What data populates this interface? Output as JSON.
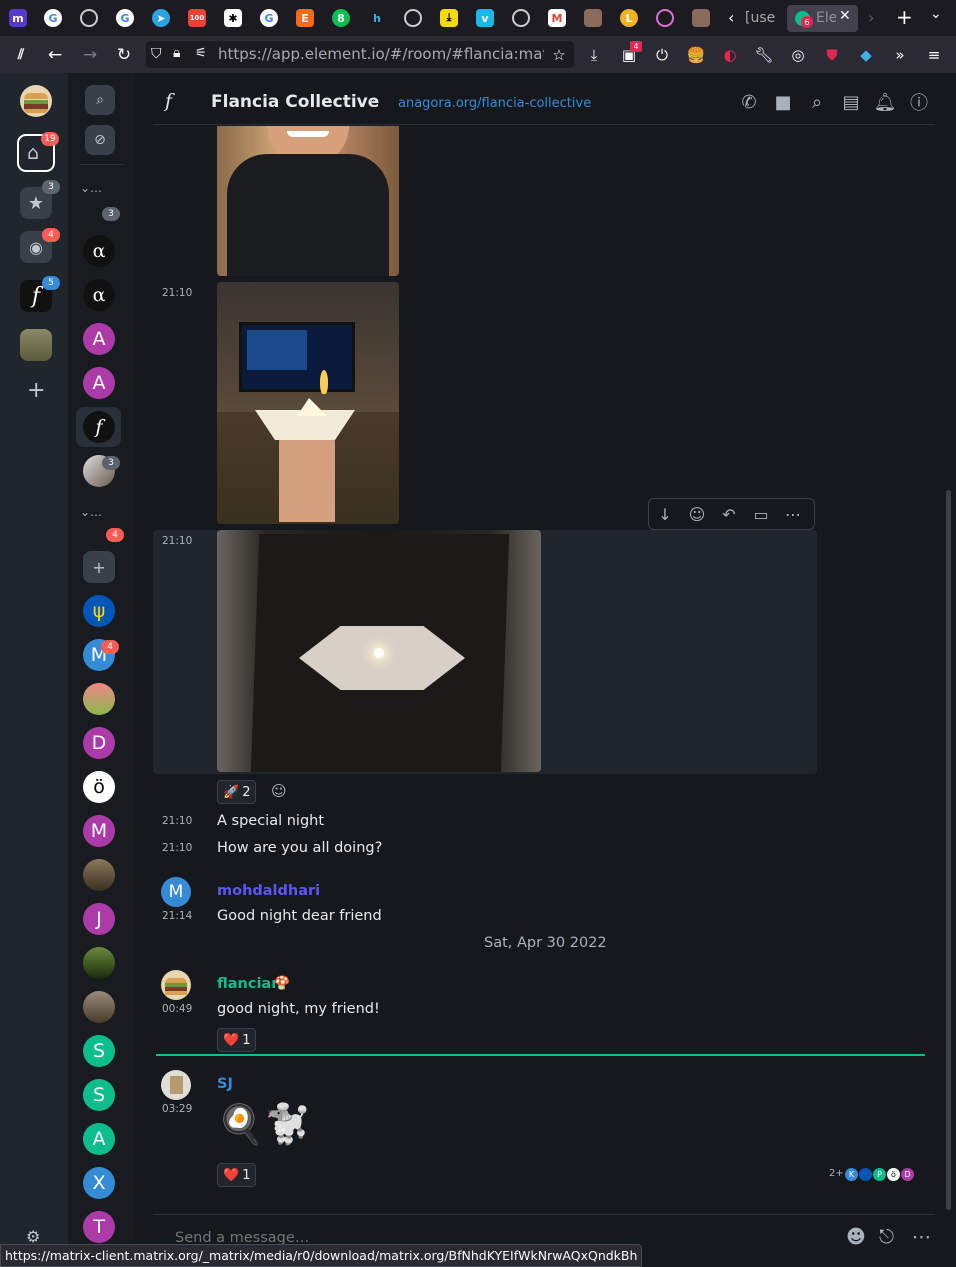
{
  "browser": {
    "url": "https://app.element.io/#/room/#flancia:matrix",
    "tabs": [
      {
        "label": "[use"
      },
      {
        "label": "Ele"
      }
    ],
    "tab_badge": "6",
    "ext_badge": "4",
    "status_url": "https://matrix-client.matrix.org/_matrix/media/r0/download/matrix.org/BfNhdKYEIfWkNrwAQxQndkBh"
  },
  "spaces": {
    "home_badge": "19",
    "favourites_badge": "3",
    "people_badge": "4",
    "flancia_badge": "5"
  },
  "roomlist": {
    "section_badge_1": "3",
    "section_badge_2": "4",
    "rooms": [
      {
        "letter": "α",
        "color": "#111111"
      },
      {
        "letter": "α",
        "color": "#111111"
      },
      {
        "letter": "A",
        "color": "#ac3ba8"
      },
      {
        "letter": "A",
        "color": "#ac3ba8"
      },
      {
        "letter": "f",
        "color": "#111111"
      },
      {
        "letter": "",
        "color": "#6b5a4a",
        "badge": "3"
      }
    ],
    "rooms2": [
      {
        "letter": "",
        "color": "#0057b8"
      },
      {
        "letter": "M",
        "color": "#368bd6",
        "badge": "4"
      },
      {
        "letter": "",
        "color": "#8db84a"
      },
      {
        "letter": "D",
        "color": "#ac3ba8"
      },
      {
        "letter": "ö",
        "color": "#ffffff"
      },
      {
        "letter": "M",
        "color": "#ac3ba8"
      },
      {
        "letter": "",
        "color": "#5a5040"
      },
      {
        "letter": "J",
        "color": "#ac3ba8"
      },
      {
        "letter": "",
        "color": "#3a5a2a"
      },
      {
        "letter": "",
        "color": "#6a5a4a"
      },
      {
        "letter": "S",
        "color": "#0dbd8b"
      },
      {
        "letter": "S",
        "color": "#0dbd8b"
      },
      {
        "letter": "A",
        "color": "#0dbd8b"
      },
      {
        "letter": "X",
        "color": "#368bd6"
      },
      {
        "letter": "T",
        "color": "#ac3ba8"
      }
    ]
  },
  "room": {
    "icon": "f",
    "name": "Flancia Collective",
    "topic": "anagora.org/flancia-collective"
  },
  "timeline": {
    "t1": "21:10",
    "t2": "21:10",
    "reaction_rocket": "🚀",
    "reaction_rocket_count": "2",
    "m1_time": "21:10",
    "m1_text": "A special night",
    "m2_time": "21:10",
    "m2_text": "How are you all doing?",
    "u1_name": "mohdaldhari",
    "u1_avatar": "M",
    "u1_time": "21:14",
    "u1_text": "Good night dear friend",
    "date_sep": "Sat, Apr 30 2022",
    "u2_name": "flancian",
    "u2_flair": "🍄",
    "u2_time": "00:49",
    "u2_text": "good night, my friend!",
    "heart": "❤️",
    "u2_react_count": "1",
    "u3_name": "SJ",
    "u3_time": "03:29",
    "u3_text": "🍳🐩",
    "u3_react_count": "1",
    "read_more": "2+",
    "read_avatars": [
      "K",
      "",
      "P",
      "ö",
      "D"
    ]
  },
  "composer": {
    "placeholder": "Send a message…"
  },
  "colors": {
    "accent": "#0dbd8b",
    "link": "#368bd6",
    "u1_color": "#5c56f5",
    "u2_color": "#0dbd8b"
  }
}
